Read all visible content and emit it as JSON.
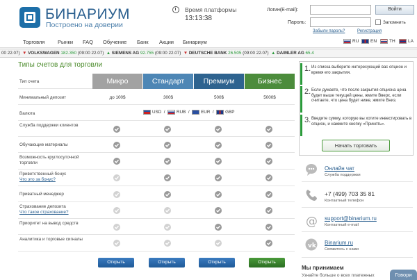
{
  "header": {
    "brand": "БИНАРИУМ",
    "tagline": "Построено на доверии",
    "platform_label": "Время платформы",
    "platform_time": "13:13:38",
    "login_label": "Логин(E-mail):",
    "password_label": "Пароль:",
    "login_button": "Войти",
    "remember_label": "Запомнить",
    "forgot_link": "Забыли пароль?",
    "register_link": "Регистрация"
  },
  "nav": {
    "items": [
      "Торговля",
      "Рынки",
      "FAQ",
      "Обучение",
      "Банк",
      "Акции",
      "Бинариум"
    ],
    "langs": [
      "RU",
      "EN",
      "TH",
      "LA"
    ]
  },
  "ticker": [
    {
      "name": "",
      "price": "",
      "time": "00 22.07)",
      "dir": ""
    },
    {
      "name": "VOLKSWAGEN",
      "price": "182.350",
      "time": "(09:00 22.07)",
      "dir": "down"
    },
    {
      "name": "SIEMENS AG",
      "price": "92.755",
      "time": "(09:00 22.07)",
      "dir": "up"
    },
    {
      "name": "DEUTSCHE BANK",
      "price": "26.505",
      "time": "(09:00 22.07)",
      "dir": "down"
    },
    {
      "name": "DAIMLER AG",
      "price": "65.4",
      "time": "",
      "dir": ""
    }
  ],
  "main": {
    "title": "Типы счетов для торговли",
    "account_type_label": "Тип счета",
    "plans": [
      {
        "name": "Микро",
        "color": "#a2a2a2",
        "deposit": "до 100$"
      },
      {
        "name": "Стандарт",
        "color": "#4d86b5",
        "deposit": "300$"
      },
      {
        "name": "Премиум",
        "color": "#2e638f",
        "deposit": "500$"
      },
      {
        "name": "Бизнес",
        "color": "#4c8c3c",
        "deposit": "5000$"
      }
    ],
    "min_deposit_label": "Минимальный депозит",
    "currency_label": "Валюта",
    "currencies": [
      "USD",
      "RUB",
      "EUR",
      "GBP"
    ],
    "features": [
      {
        "label": "Служба поддержки клиентов",
        "link": "",
        "checks": [
          true,
          true,
          true,
          true
        ]
      },
      {
        "label": "Обучающие материалы",
        "link": "",
        "checks": [
          true,
          true,
          true,
          true
        ]
      },
      {
        "label": "Возможность круглосуточной торговли",
        "link": "",
        "checks": [
          true,
          true,
          true,
          true
        ]
      },
      {
        "label": "Приветственный бонус",
        "link": "Что это за бонус?",
        "checks": [
          false,
          true,
          true,
          true
        ]
      },
      {
        "label": "Приватный менеджер",
        "link": "",
        "checks": [
          false,
          true,
          true,
          true
        ]
      },
      {
        "label": "Страхование депозита",
        "link": "Что такое страхование?",
        "checks": [
          false,
          false,
          true,
          true
        ]
      },
      {
        "label": "Приоритет на вывод средств",
        "link": "",
        "checks": [
          false,
          false,
          true,
          true
        ]
      },
      {
        "label": "Аналитика и торговые сигналы",
        "link": "",
        "checks": [
          false,
          false,
          false,
          true
        ]
      }
    ],
    "open_button": "Открыть"
  },
  "sidebar": {
    "steps": [
      {
        "num": "1.",
        "text": "Из списка выберите интересующий вас опцион и время его закрытия."
      },
      {
        "num": "2.",
        "text": "Если думаете, что после закрытия опциона цена будет выше текущей цены, жмите Вверх, если считаете, что цена будет ниже, жмите Вниз."
      },
      {
        "num": "3.",
        "text": "Введите сумму, которую вы хотите инвестировать в опцион, и нажмите кнопку «Принять»."
      }
    ],
    "start_button": "Начать торговать",
    "contacts": [
      {
        "title": "Онлайн чат",
        "sub": "Служба поддержки",
        "icon": "chat-icon"
      },
      {
        "title": "+7 (499) 703 35 81",
        "sub": "Контактный телефон",
        "icon": "phone-icon"
      },
      {
        "title": "support@binarium.ru",
        "sub": "Контактный e-mail",
        "icon": "email-icon"
      },
      {
        "title": "Binarium.ru",
        "sub": "Свяжитесь с нами",
        "icon": "vk-icon"
      }
    ],
    "accept_title": "Мы принимаем",
    "accept_text": "Узнайте больше о всех платежных"
  },
  "chat_tab": "Говори"
}
